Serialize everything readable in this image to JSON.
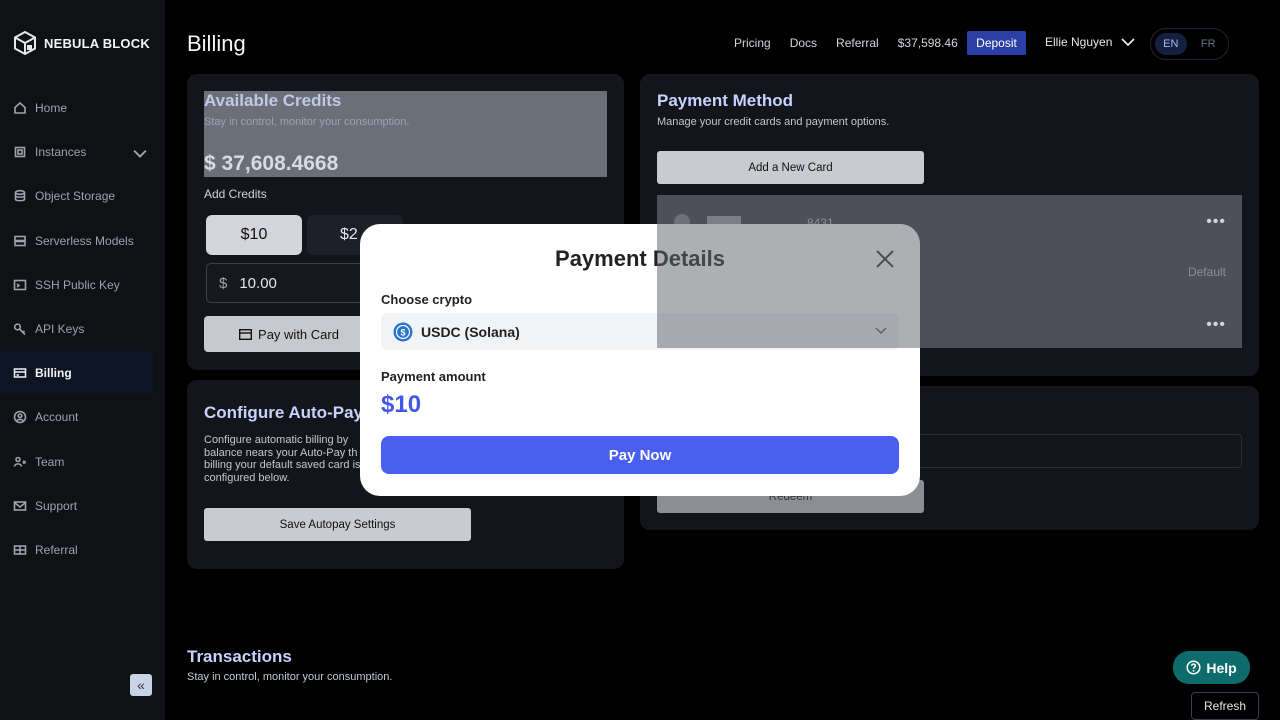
{
  "brand": {
    "name": "NEBULA BLOCK"
  },
  "sidebar": {
    "items": [
      {
        "label": "Home",
        "icon": "home-icon"
      },
      {
        "label": "Instances",
        "icon": "chip-icon"
      },
      {
        "label": "Object Storage",
        "icon": "database-icon"
      },
      {
        "label": "Serverless Models",
        "icon": "server-icon"
      },
      {
        "label": "SSH Public Key",
        "icon": "terminal-icon"
      },
      {
        "label": "API Keys",
        "icon": "key-icon"
      },
      {
        "label": "Billing",
        "icon": "card-icon",
        "active": true
      },
      {
        "label": "Account",
        "icon": "user-circle-icon"
      },
      {
        "label": "Team",
        "icon": "team-icon"
      },
      {
        "label": "Support",
        "icon": "mail-icon"
      },
      {
        "label": "Referral",
        "icon": "gift-icon"
      }
    ],
    "collapse_glyph": "«"
  },
  "header": {
    "title": "Billing",
    "links": [
      "Pricing",
      "Docs",
      "Referral"
    ],
    "balance": "$37,598.46",
    "deposit_label": "Deposit",
    "user_name": "Ellie Nguyen",
    "languages": [
      "EN",
      "FR"
    ]
  },
  "credits": {
    "title": "Available Credits",
    "subtitle": "Stay in control, monitor your consumption.",
    "amount": "$ 37,608.4668",
    "add_label": "Add Credits",
    "amount_options": [
      "$10",
      "$2"
    ],
    "currency_symbol": "$",
    "input_value": "10.00",
    "pay_card_label": "Pay with Card"
  },
  "autopay": {
    "title": "Configure Auto-Pay",
    "description": "Configure automatic billing by balance nears your Auto-Pay th billing your default saved card is configured below.",
    "save_label": "Save Autopay Settings"
  },
  "payment_method": {
    "title": "Payment Method",
    "subtitle": "Manage your credit cards and payment options.",
    "add_card_label": "Add a New Card",
    "cards": [
      {
        "last4": "8431",
        "menu": "•••"
      },
      {
        "default_label": "Default"
      },
      {
        "menu": "•••"
      }
    ]
  },
  "redeem": {
    "button_label": "Redeem"
  },
  "transactions": {
    "title": "Transactions",
    "subtitle": "Stay in control, monitor your consumption.",
    "refresh_label": "Refresh"
  },
  "help": {
    "label": "Help"
  },
  "modal": {
    "title": "Payment Details",
    "choose_label": "Choose crypto",
    "selected_crypto": "USDC (Solana)",
    "amount_label": "Payment amount",
    "amount": "$10",
    "pay_now_label": "Pay Now"
  }
}
